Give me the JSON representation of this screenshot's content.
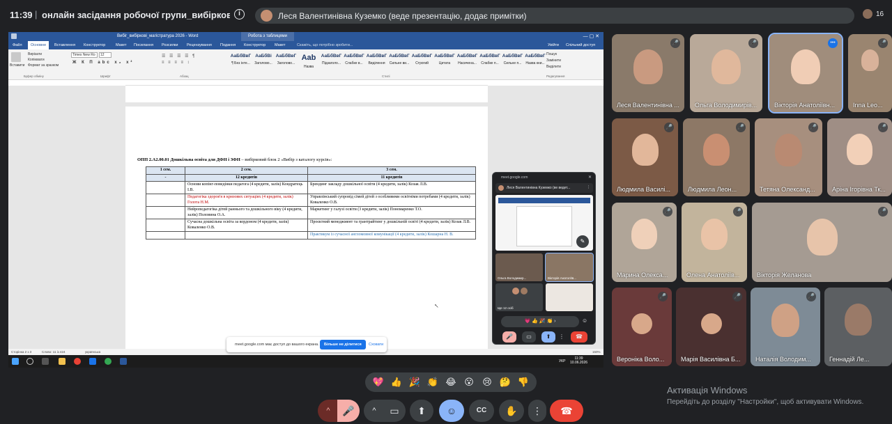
{
  "topbar": {
    "time": "11:39",
    "separator": "|",
    "meeting_title": "онлайн засідання робочої групи_вибіркові дисци...",
    "presenter_text": "Леся Валентинівна Куземко (веде презентацію, додає примітки)",
    "participant_count": "16"
  },
  "word": {
    "doc_title": "Вибіг_вибіркові_магістратура 2026 - Word",
    "context_tab": "Робота з таблицями",
    "tabs": [
      "Файл",
      "Основне",
      "Вставлення",
      "Конструктор",
      "Макет",
      "Посилання",
      "Розсилки",
      "Рецензування",
      "Подання",
      "Конструктор",
      "Макет"
    ],
    "search_hint": "Скажіть, що потрібно зробити...",
    "enter": "Увійти",
    "share": "Спільний доступ",
    "clipboard": {
      "paste": "Вставити",
      "cut": "Вирізати",
      "copy": "Копіювати",
      "format": "Формат за зразком",
      "group": "Буфер обміну"
    },
    "font_name": "Times New Ro",
    "font_size": "12",
    "font_group": "Шрифт",
    "paragraph_group": "Абзац",
    "styles": [
      {
        "sample": "АаБбВвГ",
        "name": "¶ Без інте..."
      },
      {
        "sample": "АаБбВі",
        "name": "Заголово..."
      },
      {
        "sample": "АаБбВвГ",
        "name": "Заголово..."
      },
      {
        "sample": "Aab",
        "name": "Назва"
      },
      {
        "sample": "АаБбВвГ",
        "name": "Підзаголо..."
      },
      {
        "sample": "АаБбВвГ",
        "name": "Слабке в..."
      },
      {
        "sample": "АаБбВвГ",
        "name": "Виділення"
      },
      {
        "sample": "АаБбВвГ",
        "name": "Сильне ви..."
      },
      {
        "sample": "АаБбВвГ",
        "name": "Строгий"
      },
      {
        "sample": "АаБбВвГ",
        "name": "Цитата"
      },
      {
        "sample": "АаБбВвГ",
        "name": "Насичена..."
      },
      {
        "sample": "АаБбВвГ",
        "name": "Слабке п..."
      },
      {
        "sample": "АаБбВвГ",
        "name": "Сильне п..."
      },
      {
        "sample": "АаБбВвГ",
        "name": "Назва кни..."
      }
    ],
    "styles_group": "Стилі",
    "editing": {
      "find": "Пошук",
      "replace": "Замінити",
      "select": "Виділити",
      "group": "Редагування"
    },
    "heading_bold": "ОПП 2.А2.00.01 Дошкільна освіта  для ДФН і ЗФН",
    "heading_rest": " – вибірковий блок 2 «Вибір з каталогу курсів»:",
    "table": {
      "headers": [
        "1 сем.",
        "2 сем.",
        "3 сем."
      ],
      "subheaders": [
        "-",
        "12  кредитів",
        "11  кредитів"
      ],
      "rows": [
        [
          "",
          "Основи копінг-поведінки педагога (4 кредити, залік) Кондратець І.В.",
          "Брендинг закладу дошкільної освіти (4 кредити, залік) Козак Л.В."
        ],
        [
          "",
          "Педагогіка здоров'я в кризових ситуаціях (4 кредити, залік) Голота Н.М.",
          "Управлінський  супровід сімей дітей з особливими освітніми потребами  (4 кредити, залік) Коваленко О.В."
        ],
        [
          "",
          "Нейропедагогіка дітей раннього та дошкільного віку (4 кредити, залік) Половина О.А.",
          "Маркетинг у галузі освіти (3 кредити, залік) Пономаренко Т.О."
        ],
        [
          "",
          "Сучасна дошкільна освіта за кордоном (4 кредити, залік)  Коваленко О.В.",
          "Проєктний менеджмент та грантрайтинг у дошкільній освіті (4 кредити, залік) Козак Л.В."
        ],
        [
          "",
          "",
          "Практикум із сучасної англомовної комунікації (4 кредити, залік) Кошарна Н. В."
        ]
      ]
    },
    "status_page": "Сторінка 2 з 3",
    "status_words": "Слово: 11 із 424",
    "status_lang": "українська",
    "zoom": "150%",
    "taskbar_lang": "УКР",
    "taskbar_time": "11:39",
    "taskbar_date": "10.06.2026"
  },
  "share_bar": {
    "message": "meet.google.com має доступ до вашого екрана.",
    "stop": "Більше не ділитися",
    "hide": "Сховати"
  },
  "pip": {
    "url": "meet.google.com",
    "presenter": "Леся Валентинівна Куземко (ве ведет...",
    "tiles": [
      "Ольга Володимир...",
      "Вікторія Анатоліїв...",
      "Ще 12 осіб",
      ""
    ],
    "reactions": [
      "💗",
      "👍",
      "🎉",
      "👏",
      "›"
    ]
  },
  "participants": [
    {
      "name": "Леся Валентинівна ...",
      "muted": true,
      "speaking": false
    },
    {
      "name": "Ольга Володимирів...",
      "muted": true,
      "speaking": false
    },
    {
      "name": "Вікторія Анатоліївн...",
      "muted": false,
      "speaking": true
    },
    {
      "name": "Inna Leo...",
      "muted": true,
      "speaking": false
    },
    {
      "name": "Людмила Василі...",
      "muted": true,
      "speaking": false
    },
    {
      "name": "Людмила Леон...",
      "muted": true,
      "speaking": false
    },
    {
      "name": "Тетяна Олександ...",
      "muted": true,
      "speaking": false
    },
    {
      "name": "Аріна Ігорівна Тк...",
      "muted": true,
      "speaking": false
    },
    {
      "name": "Марина Олекса...",
      "muted": true,
      "speaking": false
    },
    {
      "name": "Олена Анатоліїв...",
      "muted": true,
      "speaking": false
    },
    {
      "name": "Вікторія Желанова",
      "muted": true,
      "speaking": false
    },
    {
      "name": "Вероніка Воло...",
      "muted": true,
      "speaking": false
    },
    {
      "name": "Марія Василівна Б...",
      "muted": true,
      "speaking": false
    },
    {
      "name": "Наталія Володим...",
      "muted": true,
      "speaking": false
    },
    {
      "name": "Геннадій Ле...",
      "muted": false,
      "speaking": false
    }
  ],
  "reactions": [
    "💖",
    "👍",
    "🎉",
    "👏",
    "😂",
    "😮",
    "😢",
    "🤔",
    "👎"
  ],
  "controls": {
    "more_audio": "^",
    "mic": "🎤",
    "more_video": "^",
    "camera": "▭",
    "present": "⬆",
    "emoji": "☺",
    "captions": "CC",
    "hand": "✋",
    "more": "⋮",
    "leave": "☎"
  },
  "activation": {
    "title": "Активація Windows",
    "subtitle": "Перейдіть до розділу \"Настройки\", щоб активувати Windows."
  }
}
